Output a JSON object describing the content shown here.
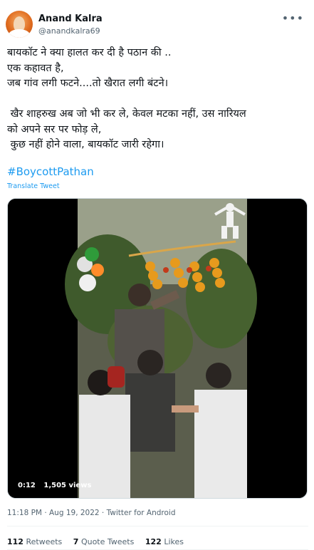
{
  "author": {
    "name": "Anand Kalra",
    "handle": "@anandkalra69"
  },
  "tweet": {
    "text": "बायकॉट ने क्या हालत कर दी है पठान की ..\nएक कहावत है,\nजब गांव लगी फटने....तो खैरात लगी बंटने।\n\n खैर शाहरुख अब जो भी कर ले, केवल मटका नहीं, उस नारियल\nको अपने सर पर फोड़ ले,\n कुछ नहीं होने वाला, बायकॉट जारी रहेगा।",
    "hashtag": "#BoycottPathan",
    "translate_label": "Translate Tweet"
  },
  "video": {
    "duration": "0:12",
    "views": "1,505 views"
  },
  "meta": {
    "timestamp": "11:18 PM · Aug 19, 2022 · Twitter for Android"
  },
  "stats": {
    "retweets_count": "112",
    "retweets_label": "Retweets",
    "quotes_count": "7",
    "quotes_label": "Quote Tweets",
    "likes_count": "122",
    "likes_label": "Likes"
  },
  "colors": {
    "link": "#1d9bf0",
    "secondary_text": "#536471"
  },
  "icons": {
    "more": "more-icon",
    "avatar": "avatar"
  }
}
